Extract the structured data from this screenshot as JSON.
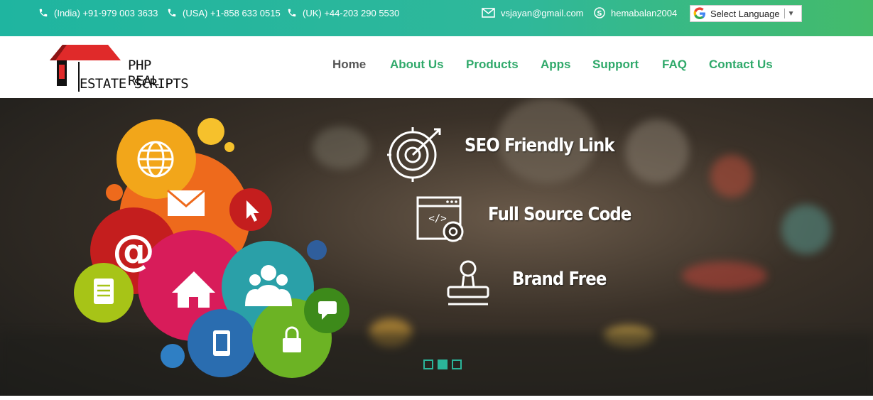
{
  "topbar": {
    "phone_india": "(India) +91-979 003 3633",
    "phone_usa": "(USA) +1-858 633 0515",
    "phone_uk": "(UK) +44-203 290 5530",
    "email": "vsjayan@gmail.com",
    "skype": "hemabalan2004",
    "language_label": "Select Language"
  },
  "logo": {
    "line1": "PHP REAL",
    "line2": "ESTATE SCRIPTS"
  },
  "nav": {
    "items": [
      {
        "label": "Home"
      },
      {
        "label": "About Us"
      },
      {
        "label": "Products"
      },
      {
        "label": "Apps"
      },
      {
        "label": "Support"
      },
      {
        "label": "FAQ"
      },
      {
        "label": "Contact Us"
      }
    ]
  },
  "hero": {
    "features": [
      {
        "label": "SEO Friendly Link",
        "icon": "target-icon"
      },
      {
        "label": "Full Source Code",
        "icon": "code-window-icon"
      },
      {
        "label": "Brand Free",
        "icon": "stamp-icon"
      }
    ],
    "slider_active_index": 1
  },
  "colors": {
    "accent": "#2fa96a",
    "topbar": "#1fb5a0"
  }
}
